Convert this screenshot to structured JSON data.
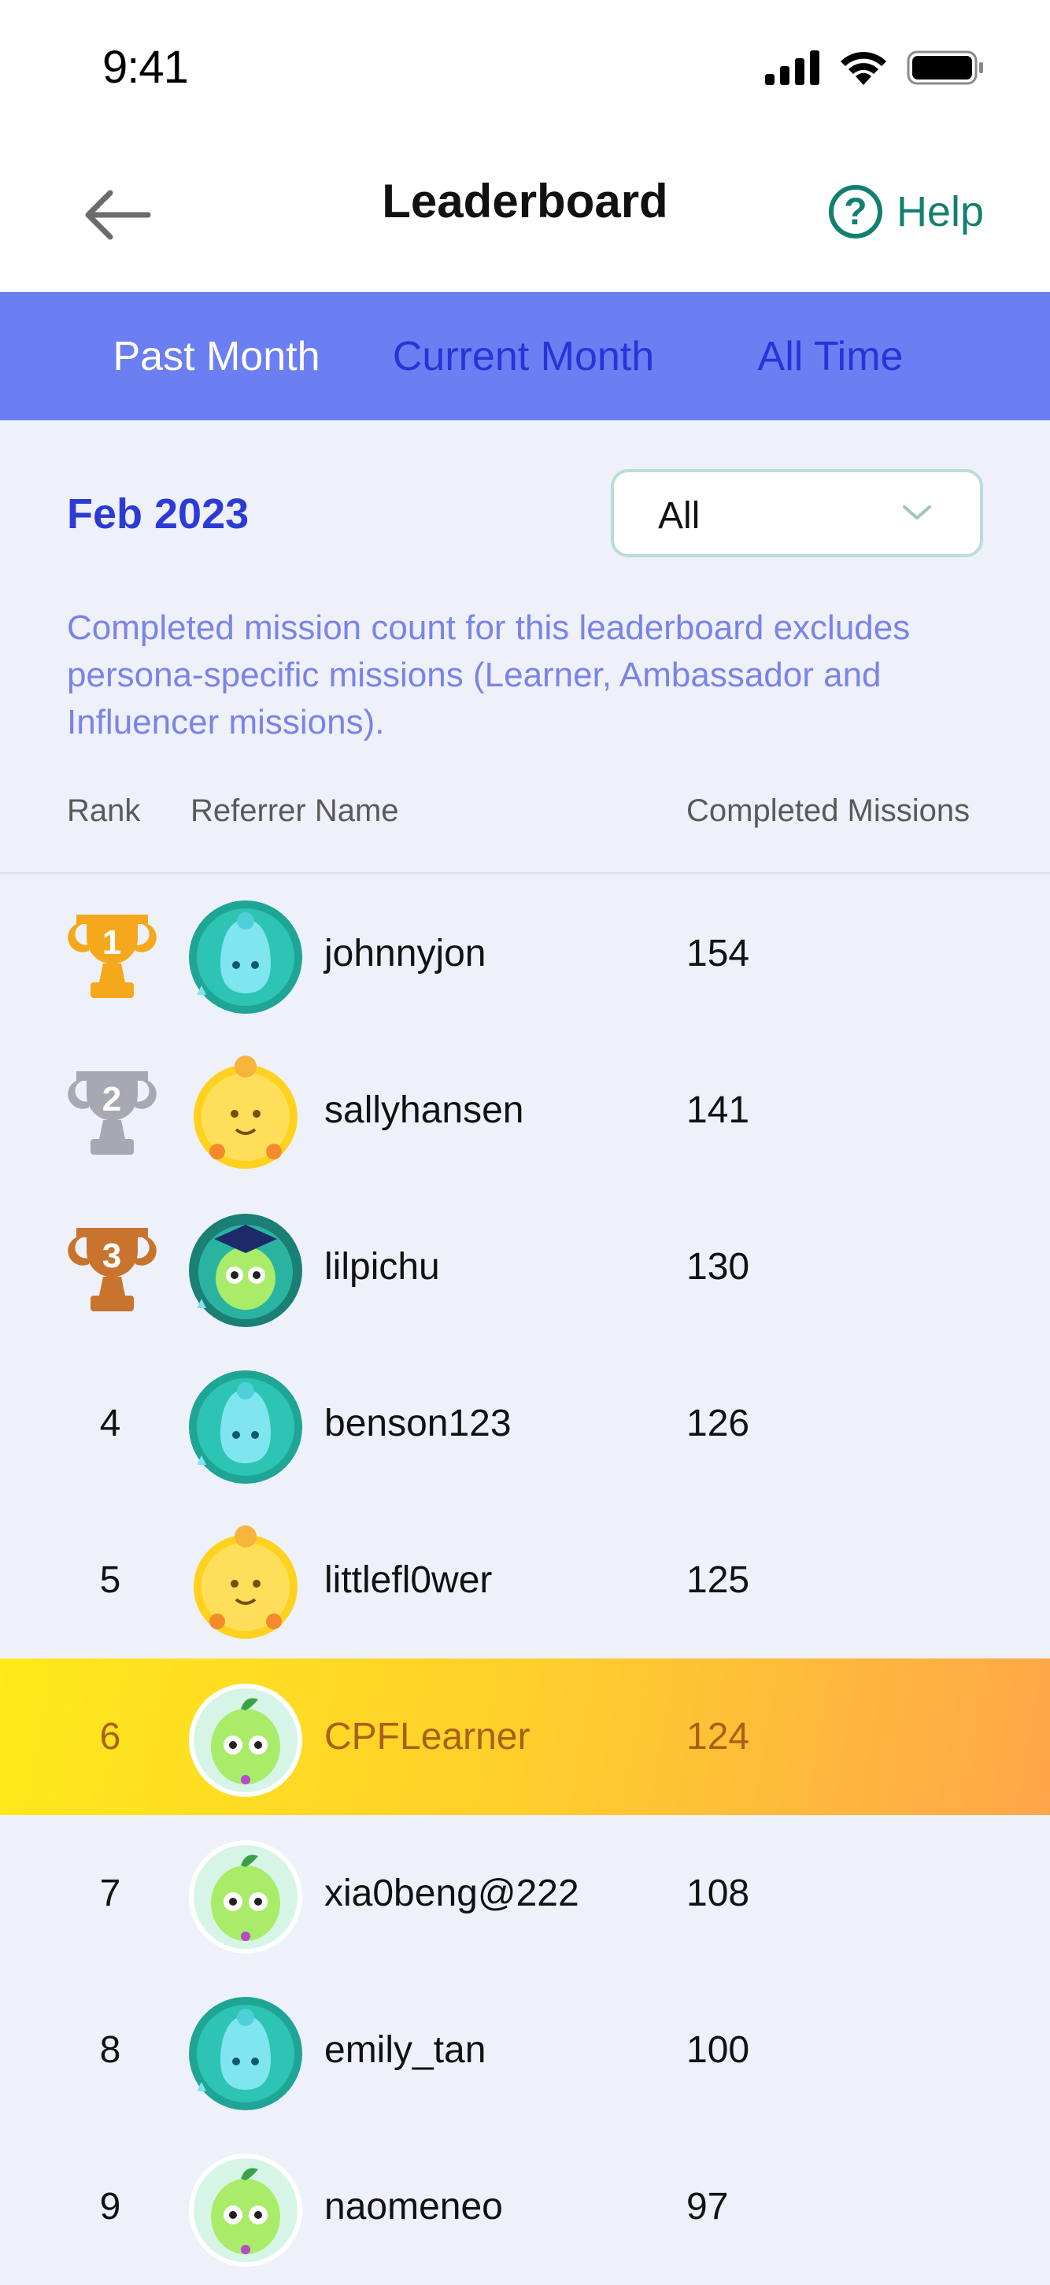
{
  "status": {
    "time": "9:41"
  },
  "header": {
    "title": "Leaderboard",
    "help_label": "Help"
  },
  "tabs": [
    {
      "label": "Past Month",
      "active": true
    },
    {
      "label": "Current Month",
      "active": false
    },
    {
      "label": "All Time",
      "active": false
    }
  ],
  "filter": {
    "month": "Feb 2023",
    "selected": "All"
  },
  "note": "Completed mission count for this leaderboard excludes persona-specific missions (Learner, Ambassador and Influencer missions).",
  "columns": {
    "rank": "Rank",
    "name": "Referrer Name",
    "missions": "Completed Missions"
  },
  "rows": [
    {
      "rank": "1",
      "name": "johnnyjon",
      "missions": "154",
      "avatar": "teal-mascot-icon"
    },
    {
      "rank": "2",
      "name": "sallyhansen",
      "missions": "141",
      "avatar": "gold-mascot-icon"
    },
    {
      "rank": "3",
      "name": "lilpichu",
      "missions": "130",
      "avatar": "graduate-mascot-icon"
    },
    {
      "rank": "4",
      "name": "benson123",
      "missions": "126",
      "avatar": "teal-mascot-icon"
    },
    {
      "rank": "5",
      "name": "littlefl0wer",
      "missions": "125",
      "avatar": "gold-mascot-icon"
    },
    {
      "rank": "6",
      "name": "CPFLearner",
      "missions": "124",
      "avatar": "green-mascot-icon",
      "current_user": true
    },
    {
      "rank": "7",
      "name": "xia0beng@222",
      "missions": "108",
      "avatar": "green-mascot-icon"
    },
    {
      "rank": "8",
      "name": "emily_tan",
      "missions": "100",
      "avatar": "teal-mascot-icon"
    },
    {
      "rank": "9",
      "name": "naomeneo",
      "missions": "97",
      "avatar": "green-mascot-icon"
    }
  ],
  "colors": {
    "accent_green": "#128070",
    "tab_bar": "#6b7ff2",
    "tab_inactive": "#2833d8",
    "highlight_start": "#ffe91a",
    "highlight_end": "#ffa64a",
    "gold": "#f6a81c",
    "silver": "#a8a8b2",
    "bronze": "#c9742e"
  }
}
